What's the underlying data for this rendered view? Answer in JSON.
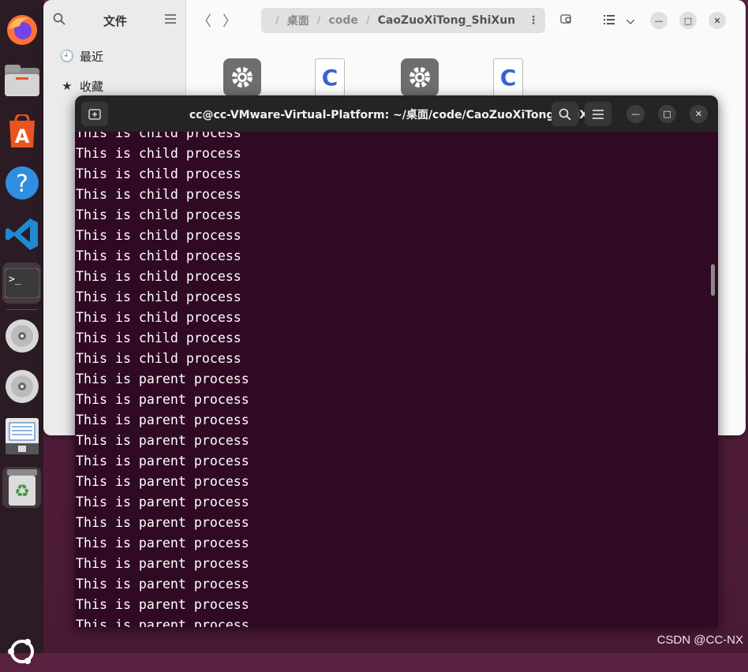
{
  "dock": {
    "items": [
      {
        "name": "firefox-icon"
      },
      {
        "name": "files-icon"
      },
      {
        "name": "app-center-icon",
        "glyph": "A"
      },
      {
        "name": "help-icon",
        "glyph": "?"
      },
      {
        "name": "vscode-icon"
      },
      {
        "name": "terminal-icon",
        "glyph": ">_"
      },
      {
        "name": "disc-icon"
      },
      {
        "name": "disc-icon-2"
      },
      {
        "name": "document-viewer-icon"
      },
      {
        "name": "trash-icon",
        "glyph": "♻"
      }
    ]
  },
  "files": {
    "sidebar_title": "文件",
    "sidebar_items": [
      {
        "icon": "🕘",
        "label": "最近"
      },
      {
        "icon": "★",
        "label": "收藏"
      }
    ],
    "breadcrumb": [
      "桌面",
      "code",
      "CaoZuoXiTong_ShiXun"
    ],
    "nav_back": "〈",
    "nav_forward": "〉",
    "file_icons": [
      "gear",
      "c",
      "gear",
      "c"
    ]
  },
  "terminal": {
    "title": "cc@cc-VMware-Virtual-Platform: ~/桌面/code/CaoZuoXiTong_ShiXun",
    "lines": [
      "This is child process",
      "This is child process",
      "This is child process",
      "This is child process",
      "This is child process",
      "This is child process",
      "This is child process",
      "This is child process",
      "This is child process",
      "This is child process",
      "This is child process",
      "This is child process",
      "This is parent process",
      "This is parent process",
      "This is parent process",
      "This is parent process",
      "This is parent process",
      "This is parent process",
      "This is parent process",
      "This is parent process",
      "This is parent process",
      "This is parent process",
      "This is parent process",
      "This is parent process",
      "This is parent process"
    ]
  },
  "watermark": "CSDN @CC-NX"
}
